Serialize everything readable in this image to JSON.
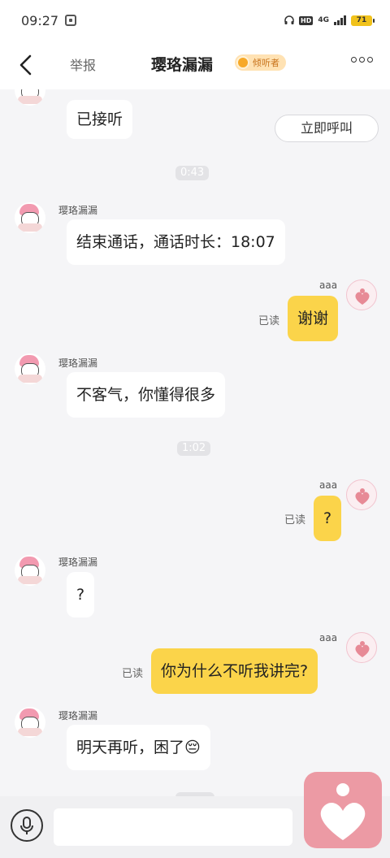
{
  "status_bar": {
    "time": "09:27",
    "network": "4G",
    "hd": "HD",
    "battery": "71"
  },
  "header": {
    "report_label": "举报",
    "title": "璎珞漏漏",
    "role_badge": "倾听者"
  },
  "colors": {
    "accent_yellow": "#fbd44a",
    "badge_bg": "#ffe2b3",
    "heart_pink": "#ec9aa4"
  },
  "messages": {
    "m0": {
      "text": "已接听",
      "action": "立即呼叫"
    },
    "t1": "0:43",
    "m1": {
      "sender": "璎珞漏漏",
      "text": "结束通话，通话时长：18:07"
    },
    "m2": {
      "sender": "aaa",
      "text": "谢谢",
      "status": "已读"
    },
    "m3": {
      "sender": "璎珞漏漏",
      "text": "不客气，你懂得很多"
    },
    "t2": "1:02",
    "m4": {
      "sender": "aaa",
      "text": "?",
      "status": "已读"
    },
    "m5": {
      "sender": "璎珞漏漏",
      "text": "?"
    },
    "m6": {
      "sender": "aaa",
      "text": "你为什么不听我讲完?",
      "status": "已读"
    },
    "m7": {
      "sender": "璎珞漏漏",
      "text": "明天再听，困了😔"
    }
  },
  "input": {
    "value": "",
    "placeholder": ""
  }
}
